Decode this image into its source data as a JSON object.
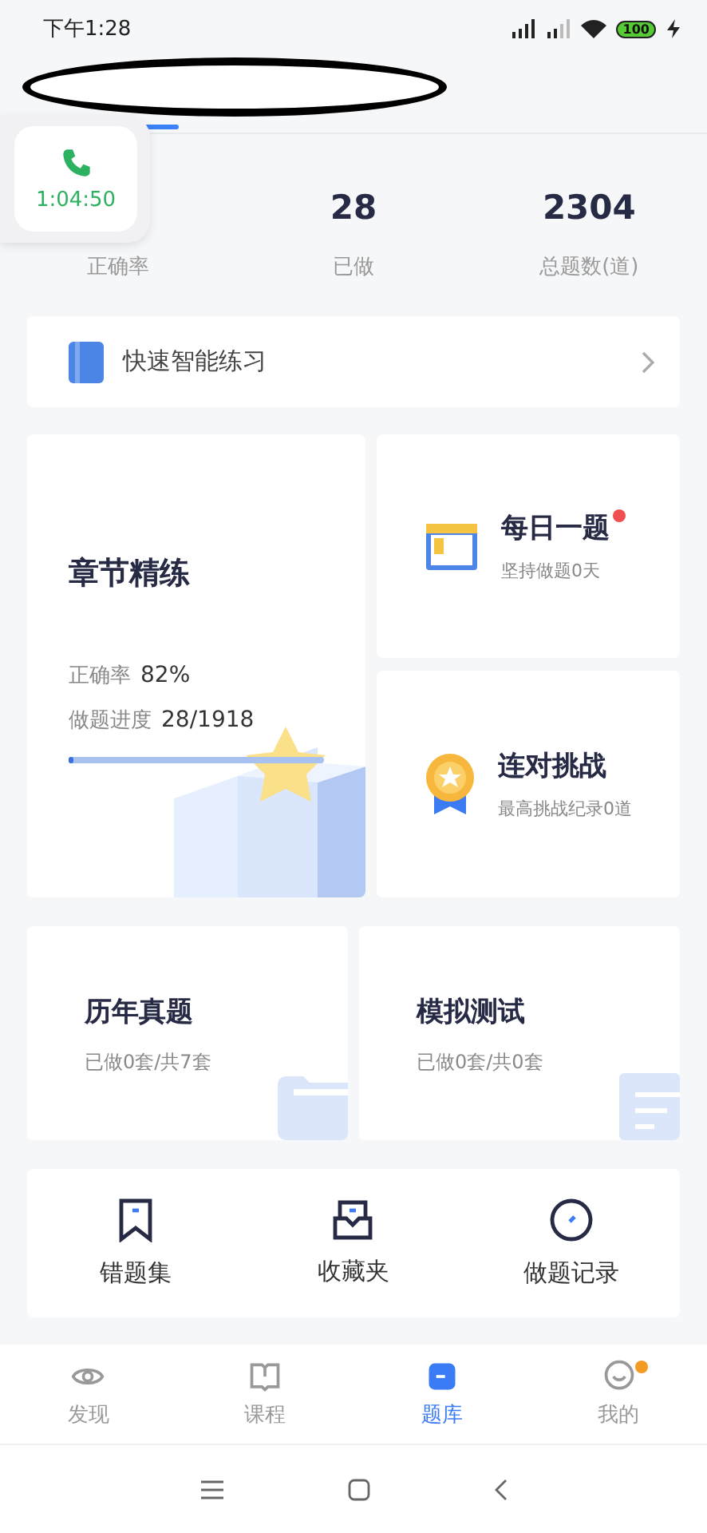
{
  "status_bar": {
    "time": "下午1:28",
    "battery": "100"
  },
  "call_bubble": {
    "duration": "1:04:50"
  },
  "stats": [
    {
      "label": "正确率"
    },
    {
      "value": "28",
      "label": "已做"
    },
    {
      "value": "2304",
      "label": "总题数(道)"
    }
  ],
  "quick_practice": {
    "label": "快速智能练习"
  },
  "chapter": {
    "title": "章节精练",
    "accuracy_label": "正确率",
    "accuracy": "82%",
    "progress_label": "做题进度",
    "progress": "28/1918",
    "level": 0.015
  },
  "side_cards": [
    {
      "kind": "calendar",
      "title": "每日一题",
      "subtitle": "坚持做题0天",
      "badge": true
    },
    {
      "kind": "medal",
      "title": "连对挑战",
      "subtitle": "最高挑战纪录0道",
      "badge": false
    }
  ],
  "exam_cards": [
    {
      "kind": "folder",
      "title": "历年真题",
      "subtitle": "已做0套/共7套"
    },
    {
      "kind": "document",
      "title": "模拟测试",
      "subtitle": "已做0套/共0套"
    }
  ],
  "tools": [
    {
      "kind": "bookmark",
      "label": "错题集"
    },
    {
      "kind": "inbox",
      "label": "收藏夹"
    },
    {
      "kind": "clock",
      "label": "做题记录"
    }
  ],
  "tabs": [
    {
      "kind": "eye",
      "label": "发现",
      "selected": false,
      "badge": false
    },
    {
      "kind": "book",
      "label": "课程",
      "selected": false,
      "badge": false
    },
    {
      "kind": "bank",
      "label": "题库",
      "selected": true,
      "badge": false
    },
    {
      "kind": "face",
      "label": "我的",
      "selected": false,
      "badge": true
    }
  ]
}
